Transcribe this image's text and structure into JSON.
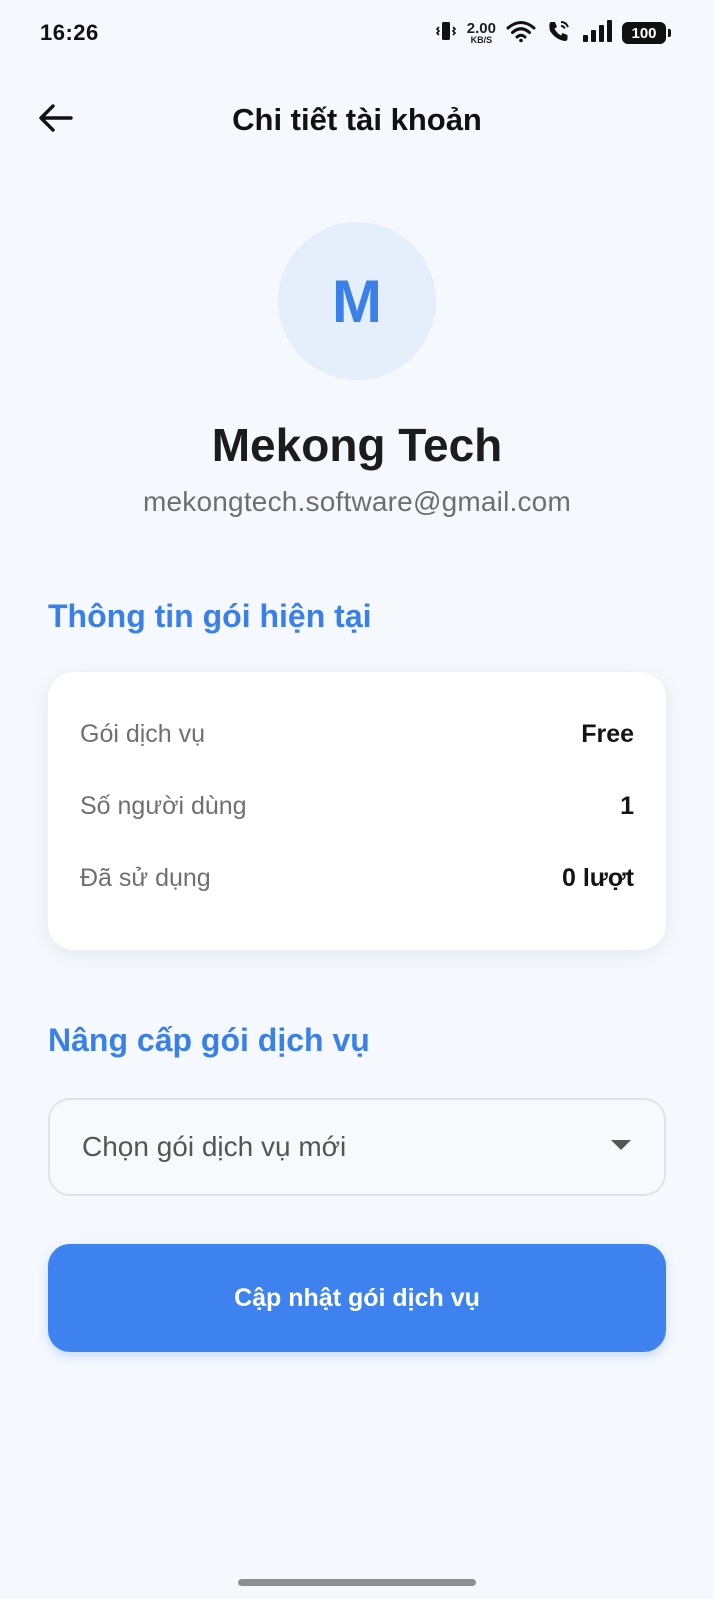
{
  "status_bar": {
    "time": "16:26",
    "net_speed_value": "2.00",
    "net_speed_unit": "KB/S",
    "battery": "100"
  },
  "header": {
    "title": "Chi tiết tài khoản",
    "back_icon": "arrow-left-icon"
  },
  "profile": {
    "avatar_initial": "M",
    "name": "Mekong Tech",
    "email": "mekongtech.software@gmail.com"
  },
  "current_plan": {
    "section_title": "Thông tin gói hiện tại",
    "rows": [
      {
        "label": "Gói dịch vụ",
        "value": "Free"
      },
      {
        "label": "Số người dùng",
        "value": "1"
      },
      {
        "label": "Đã sử dụng",
        "value": "0 lượt"
      }
    ]
  },
  "upgrade": {
    "section_title": "Nâng cấp gói dịch vụ",
    "dropdown_placeholder": "Chọn gói dịch vụ mới",
    "submit_label": "Cập nhật gói dịch vụ"
  },
  "colors": {
    "accent": "#3B80E8",
    "button": "#3D82EE",
    "background": "#F5F8FC",
    "avatar_bg": "#E5EEFB"
  }
}
